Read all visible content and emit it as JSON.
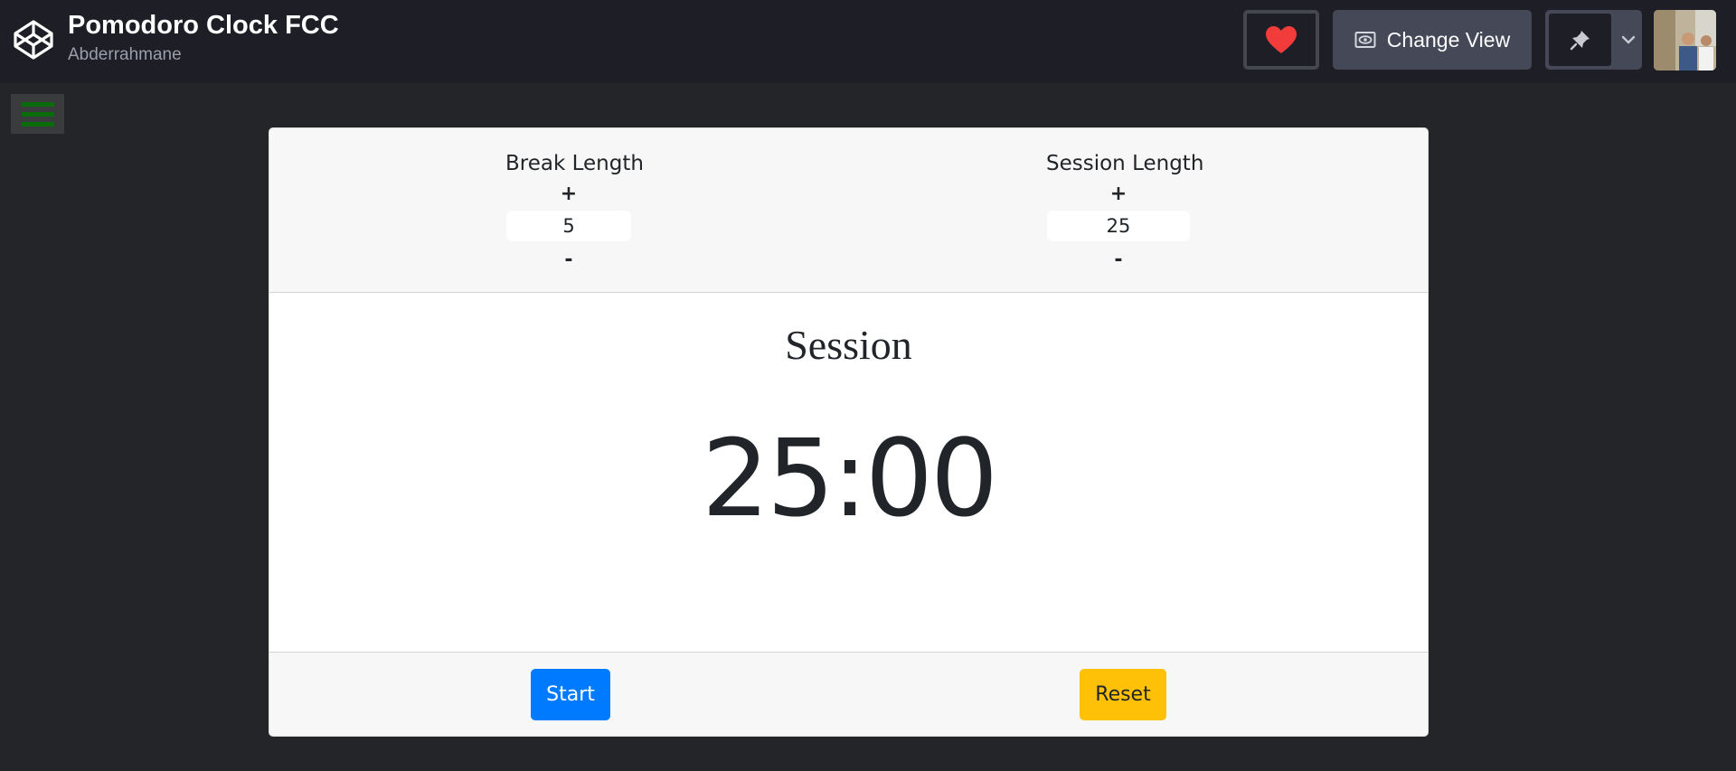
{
  "header": {
    "title": "Pomodoro Clock FCC",
    "author": "Abderrahmane",
    "change_view_label": "Change View",
    "heart_color": "#f23c3c"
  },
  "menu": {
    "icon": "hamburger-icon",
    "color": "#0a6b0a"
  },
  "clock": {
    "break": {
      "label": "Break Length",
      "increment": "+",
      "value": "5",
      "decrement": "-"
    },
    "session": {
      "label": "Session Length",
      "increment": "+",
      "value": "25",
      "decrement": "-"
    },
    "mode_label": "Session",
    "time_left": "25:00",
    "start_label": "Start",
    "reset_label": "Reset"
  },
  "colors": {
    "start": "#007bff",
    "reset": "#ffc107",
    "topbar": "#1e1f26",
    "background": "#242528"
  }
}
